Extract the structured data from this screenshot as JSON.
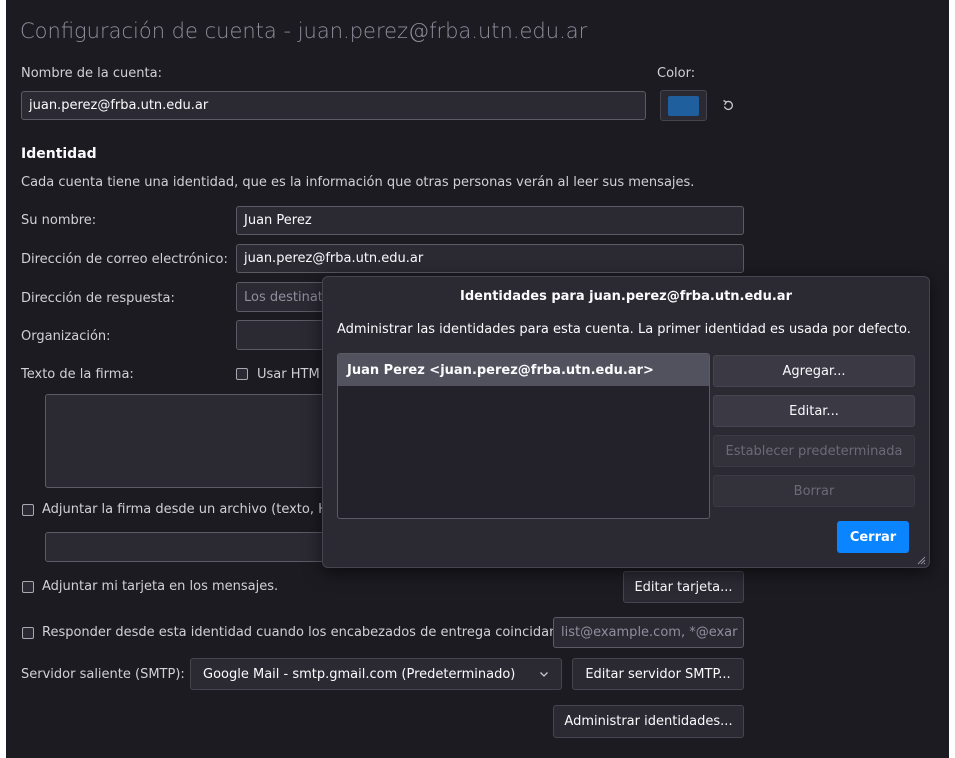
{
  "page_title": "Configuración de cuenta - juan.perez@frba.utn.edu.ar",
  "account": {
    "name_label": "Nombre de la cuenta:",
    "name_value": "juan.perez@frba.utn.edu.ar",
    "color_label": "Color:",
    "color_value": "#1f5f9e",
    "reset_icon": "undo-icon"
  },
  "identity": {
    "heading": "Identidad",
    "description": "Cada cuenta tiene una identidad, que es la información que otras personas verán al leer sus mensajes.",
    "name_label": "Su nombre:",
    "name_value": "Juan Perez",
    "email_label": "Dirección de correo electrónico:",
    "email_value": "juan.perez@frba.utn.edu.ar",
    "reply_label": "Dirección de respuesta:",
    "reply_placeholder": "Los destinat",
    "org_label": "Organización:",
    "org_value": "",
    "signature_label": "Texto de la firma:",
    "use_html_label": "Usar HTM",
    "attach_signature_label": "Adjuntar la firma desde un archivo (texto, H",
    "attach_card_label": "Adjuntar mi tarjeta en los mensajes.",
    "edit_card_button": "Editar tarjeta...",
    "reply_from_label": "Responder desde esta identidad cuando los encabezados de entrega coincidan:",
    "reply_from_placeholder": "list@example.com, *@exar",
    "smtp_label": "Servidor saliente (SMTP):",
    "smtp_value": "Google Mail - smtp.gmail.com (Predeterminado)",
    "edit_smtp_button": "Editar servidor SMTP...",
    "manage_identities_button": "Administrar identidades..."
  },
  "dialog": {
    "title": "Identidades para juan.perez@frba.utn.edu.ar",
    "description": "Administrar las identidades para esta cuenta. La primer identidad es usada por defecto.",
    "identities": [
      "Juan Perez <juan.perez@frba.utn.edu.ar>"
    ],
    "add_button": "Agregar...",
    "edit_button": "Editar...",
    "set_default_button": "Establecer predeterminada",
    "delete_button": "Borrar",
    "close_button": "Cerrar",
    "accent_color": "#0a84ff"
  }
}
